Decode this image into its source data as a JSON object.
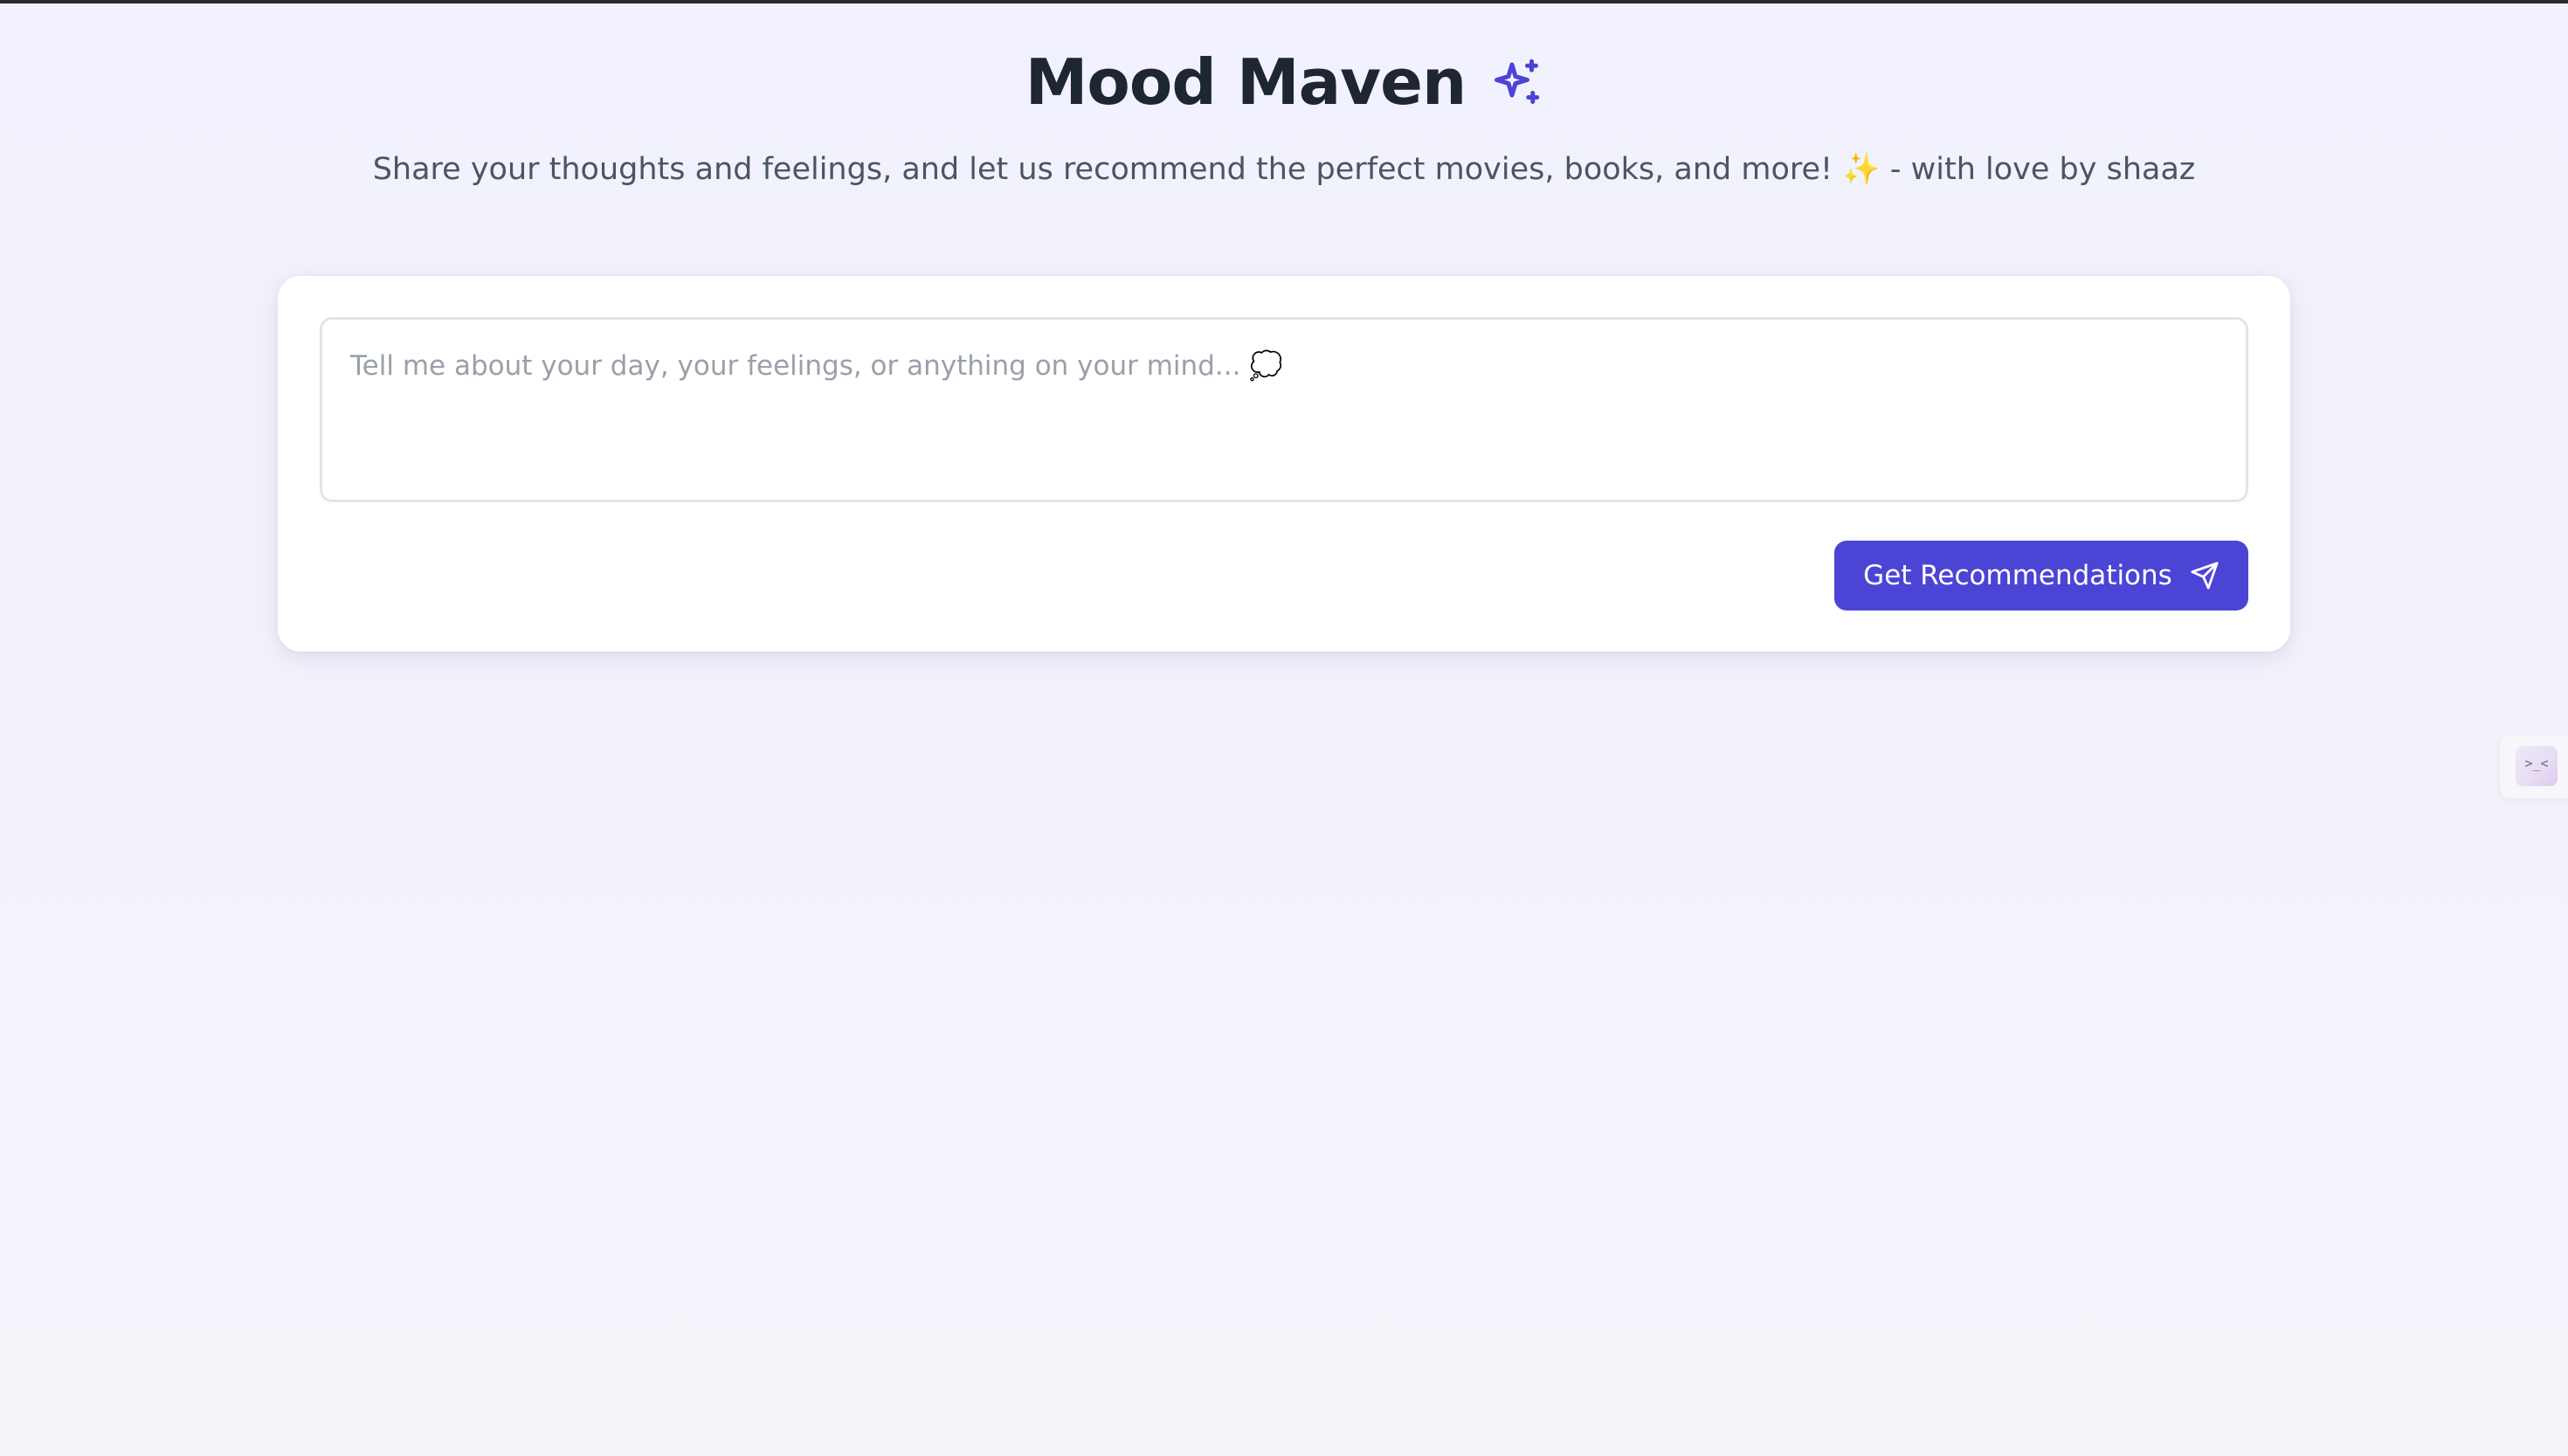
{
  "header": {
    "title": "Mood Maven",
    "title_icon": "sparkles-icon",
    "subtitle": "Share your thoughts and feelings, and let us recommend the perfect movies, books, and more! ✨ - with love by shaaz"
  },
  "form": {
    "input_value": "",
    "input_placeholder": "Tell me about your day, your feelings, or anything on your mind... 💭",
    "submit_label": "Get Recommendations",
    "submit_icon": "send-icon"
  },
  "side_widget": {
    "icon": "face-icon",
    "glyph": ">_<"
  },
  "colors": {
    "accent": "#4c44d4",
    "title": "#1e2533",
    "subtitle": "#4b5563",
    "background": "#f2f2fc"
  }
}
